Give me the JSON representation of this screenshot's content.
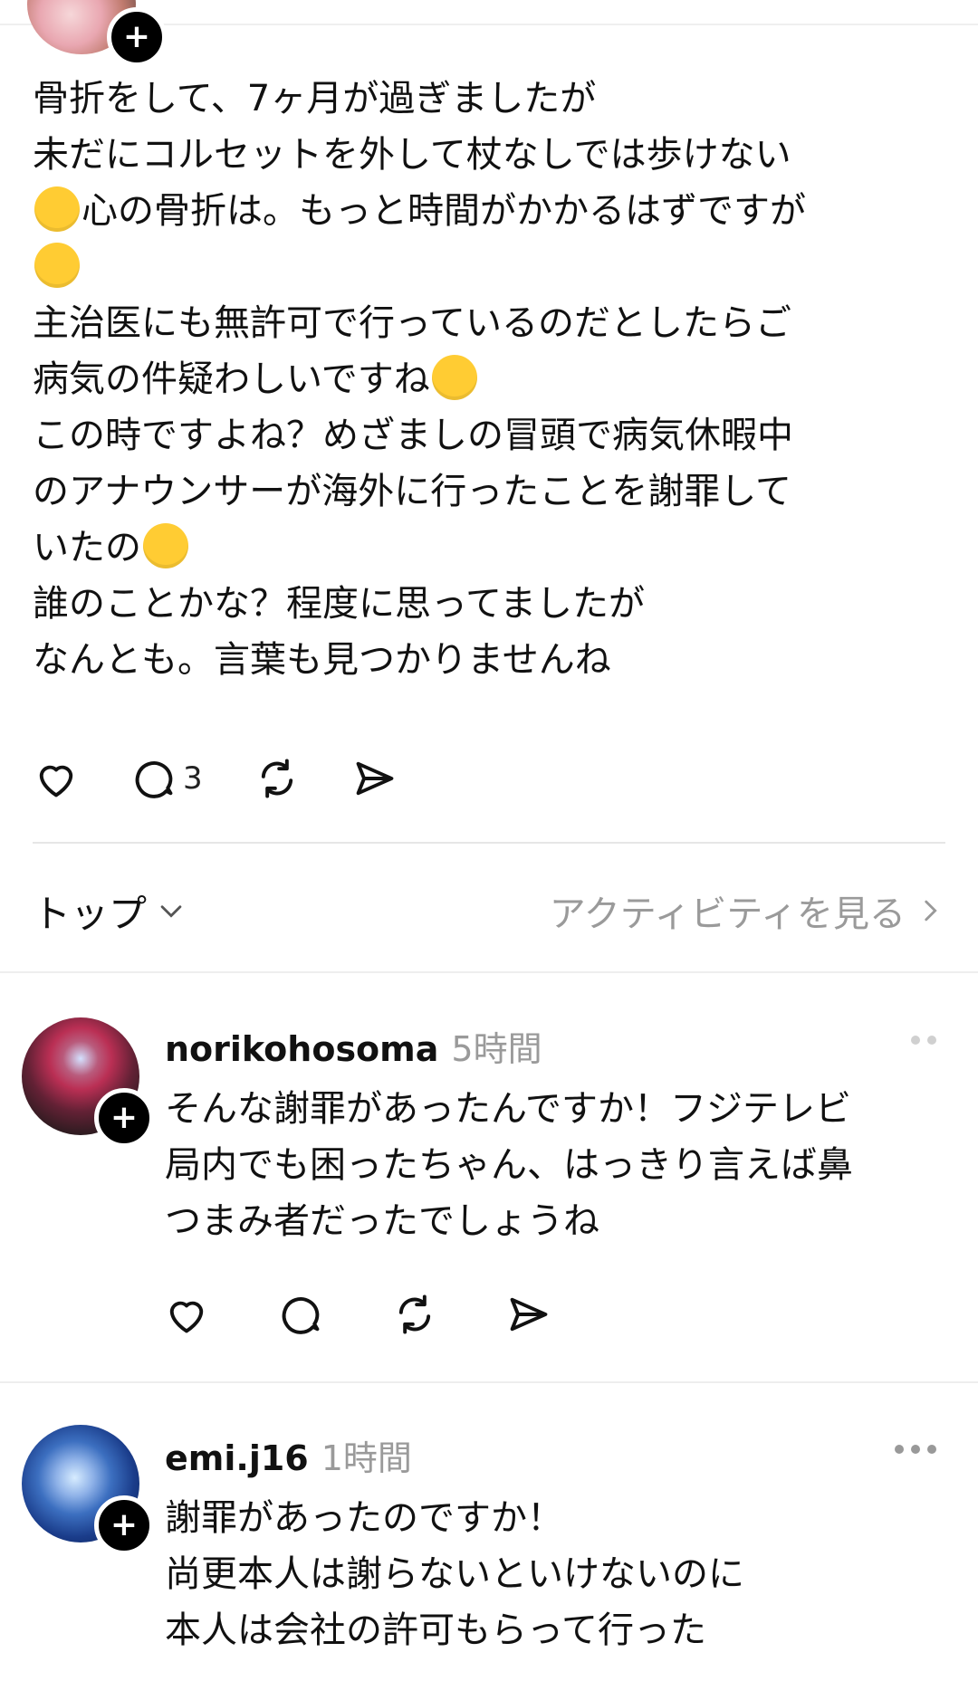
{
  "post": {
    "lines": [
      "骨折をして、7ヶ月が過ぎましたが",
      "未だにコルセットを外して杖なしでは歩けない",
      "心の骨折は。もっと時間がかかるはずですが",
      "",
      "主治医にも無許可で行っているのだとしたらご",
      "病気の件疑わしいですね",
      "この時ですよね？めざましの冒頭で病気休暇中",
      "のアナウンサーが海外に行ったことを謝罪して",
      "いたの",
      "誰のことかな？程度に思ってましたが",
      "なんとも。言葉も見つかりませんね"
    ],
    "reply_count": "3"
  },
  "sort": {
    "label": "トップ",
    "activity_link": "アクティビティを見る"
  },
  "comments": [
    {
      "username": "norikohosoma",
      "time": "5時間",
      "lines": [
        "そんな謝罪があったんですか！フジテレビ",
        "局内でも困ったちゃん、はっきり言えば鼻",
        "つまみ者だったでしょうね"
      ]
    },
    {
      "username": "emi.j16",
      "time": "1時間",
      "lines": [
        "謝罪があったのですか！",
        "尚更本人は謝らないといけないのに",
        "本人は会社の許可もらって行った"
      ]
    }
  ],
  "icons": {
    "like": "heart-icon",
    "reply": "comment-bubble-icon",
    "repost": "repost-icon",
    "share": "send-icon",
    "follow": "plus-icon",
    "more": "more-dots-icon",
    "chevron_down": "chevron-down-icon",
    "chevron_right": "chevron-right-icon"
  }
}
